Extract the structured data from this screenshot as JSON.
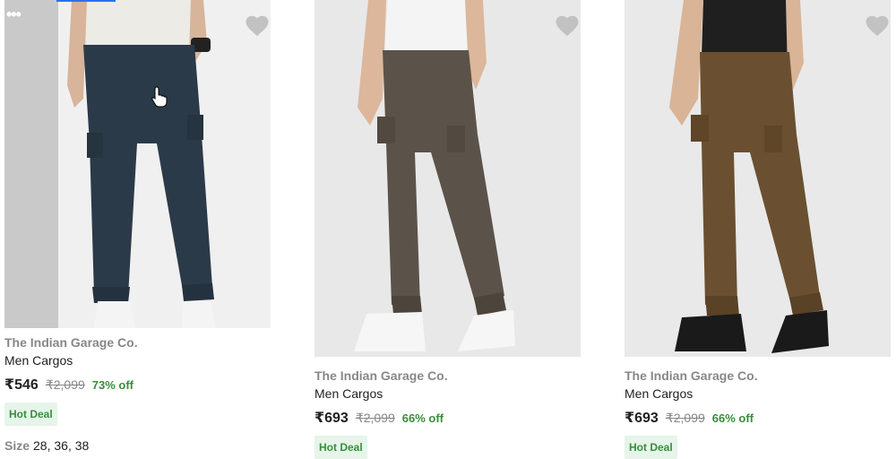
{
  "products": [
    {
      "brand": "The Indian Garage Co.",
      "title": "Men Cargos",
      "price": "₹546",
      "mrp": "₹2,099",
      "discount": "73% off",
      "badge": "Hot Deal",
      "size_label": "Size",
      "sizes": "28, 36, 38",
      "pant_color": "#2b3a48",
      "shirt_color": "#ecebe6",
      "wishlist_icon": "heart-icon"
    },
    {
      "brand": "The Indian Garage Co.",
      "title": "Men Cargos",
      "price": "₹693",
      "mrp": "₹2,099",
      "discount": "66% off",
      "badge": "Hot Deal",
      "pant_color": "#5b5349",
      "shirt_color": "#f4f4f4",
      "wishlist_icon": "heart-icon"
    },
    {
      "brand": "The Indian Garage Co.",
      "title": "Men Cargos",
      "price": "₹693",
      "mrp": "₹2,099",
      "discount": "66% off",
      "badge": "Hot Deal",
      "pant_color": "#6a5030",
      "shirt_color": "#1f1f1f",
      "wishlist_icon": "heart-icon"
    }
  ],
  "colors": {
    "discount_green": "#388e3c",
    "badge_bg": "#e6f4ea",
    "muted_text": "#878787",
    "accent_blue": "#2874f0"
  },
  "more_options_icon": "more-dots-icon",
  "cursor_icon": "hand-pointer-icon"
}
